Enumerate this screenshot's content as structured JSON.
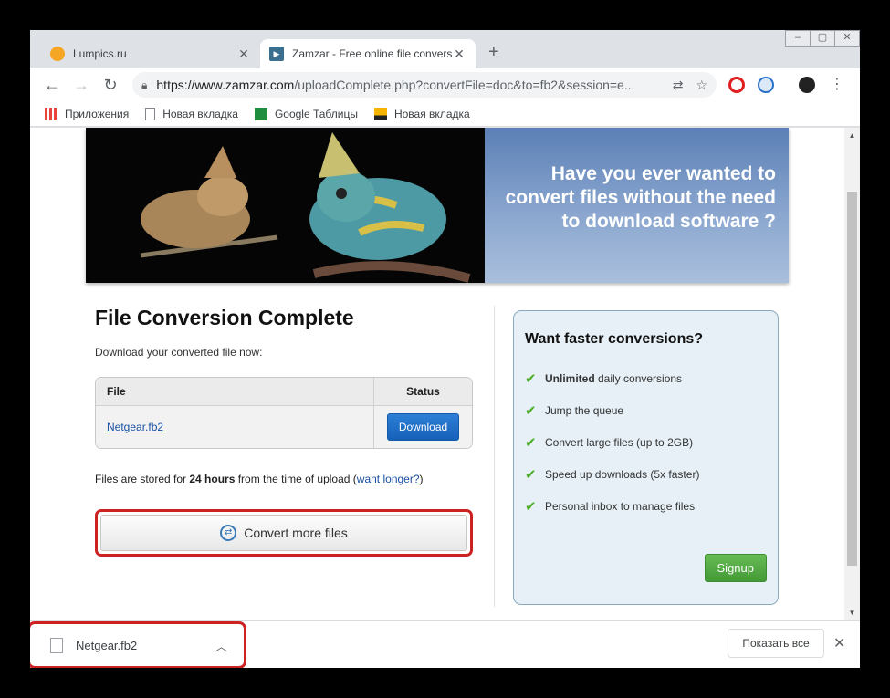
{
  "tabs": [
    {
      "title": "Lumpics.ru",
      "active": false
    },
    {
      "title": "Zamzar - Free online file convers",
      "active": true
    }
  ],
  "omnibox": {
    "url_prefix": "https://www.zamzar.com",
    "url_rest": "/uploadComplete.php?convertFile=doc&to=fb2&session=e..."
  },
  "bookmarks": [
    {
      "label": "Приложения",
      "icon": "apps-grid-icon"
    },
    {
      "label": "Новая вкладка",
      "icon": "page-icon"
    },
    {
      "label": "Google Таблицы",
      "icon": "sheets-icon"
    },
    {
      "label": "Новая вкладка",
      "icon": "image-icon"
    }
  ],
  "banner": {
    "headline": "Have you ever wanted to convert files without the need to download software ?"
  },
  "main": {
    "title": "File Conversion Complete",
    "subtitle": "Download your converted file now:",
    "table": {
      "col_file": "File",
      "col_status": "Status",
      "file_name": "Netgear.fb2",
      "download_label": "Download"
    },
    "stored": {
      "pre": "Files are stored for ",
      "bold": "24 hours",
      "mid": " from the time of upload (",
      "link": "want longer?",
      "post": ")"
    },
    "convert_more": "Convert more files"
  },
  "promo": {
    "title": "Want faster conversions?",
    "items": [
      {
        "bold": "Unlimited",
        "text": " daily conversions"
      },
      {
        "bold": "",
        "text": "Jump the queue"
      },
      {
        "bold": "",
        "text": "Convert large files (up to 2GB)"
      },
      {
        "bold": "",
        "text": "Speed up downloads (5x faster)"
      },
      {
        "bold": "",
        "text": "Personal inbox to manage files"
      }
    ],
    "signup": "Signup"
  },
  "downloads": {
    "file": "Netgear.fb2",
    "show_all": "Показать все"
  },
  "colors": {
    "highlight": "#cc2222",
    "download_button": "#1660b8",
    "signup_button": "#449a38"
  }
}
